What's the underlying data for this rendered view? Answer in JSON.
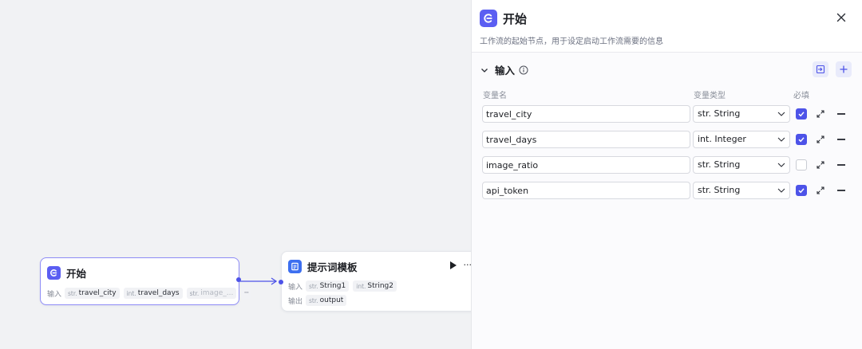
{
  "canvas": {
    "start_node": {
      "title": "开始",
      "input_label": "输入",
      "inputs": [
        {
          "type": "str.",
          "name": "travel_city"
        },
        {
          "type": "int.",
          "name": "travel_days"
        },
        {
          "type": "str.",
          "name": "image_..."
        }
      ],
      "more": "···"
    },
    "prompt_node": {
      "title": "提示词模板",
      "more": "···",
      "input_label": "输入",
      "inputs": [
        {
          "type": "str.",
          "name": "String1"
        },
        {
          "type": "int.",
          "name": "String2"
        }
      ],
      "output_label": "输出",
      "outputs": [
        {
          "type": "str.",
          "name": "output"
        }
      ]
    }
  },
  "panel": {
    "title": "开始",
    "description": "工作流的起始节点，用于设定启动工作流需要的信息",
    "section_title": "输入",
    "columns": {
      "name": "变量名",
      "type": "变量类型",
      "required": "必填"
    },
    "variables": [
      {
        "name": "travel_city",
        "type": "str. String",
        "required": true
      },
      {
        "name": "travel_days",
        "type": "int. Integer",
        "required": true
      },
      {
        "name": "image_ratio",
        "type": "str. String",
        "required": false
      },
      {
        "name": "api_token",
        "type": "str. String",
        "required": true
      }
    ]
  },
  "colors": {
    "accent": "#4d53e8",
    "node_start_icon": "#5b5ef2",
    "node_prompt_icon": "#3d6ff0"
  },
  "icons": [
    "start-icon",
    "prompt-template-icon",
    "close-icon",
    "chevron-down-icon",
    "info-icon",
    "import-icon",
    "plus-icon",
    "checkbox-checked-icon",
    "expand-icon",
    "minus-icon",
    "play-icon",
    "more-icon"
  ]
}
